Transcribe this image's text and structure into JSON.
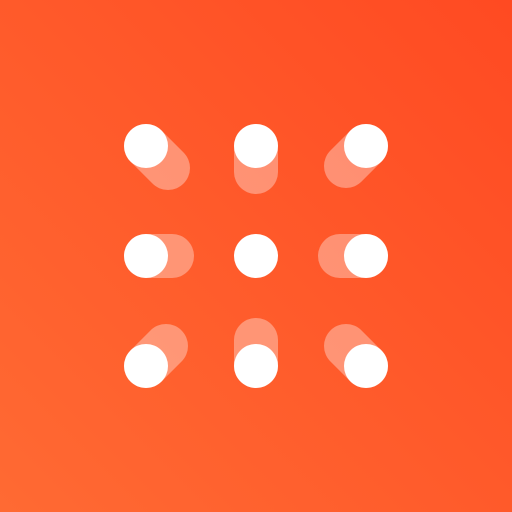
{
  "icon": {
    "name": "nine-dot-motion-grid-icon",
    "background_gradient": [
      "#FF6A33",
      "#FF4A22"
    ],
    "dot_color": "#FFFFFF",
    "trail_color": "#FFFFFF",
    "trail_opacity": 0.35
  }
}
